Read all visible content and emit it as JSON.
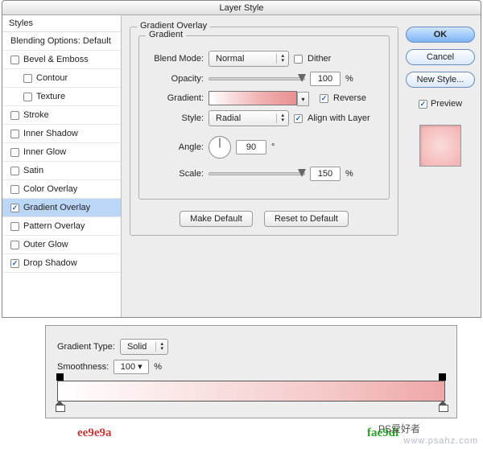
{
  "dialog": {
    "title": "Layer Style"
  },
  "sidebar": {
    "header": "Styles",
    "blending": "Blending Options: Default",
    "items": [
      {
        "label": "Bevel & Emboss",
        "checked": false,
        "sub": false
      },
      {
        "label": "Contour",
        "checked": false,
        "sub": true
      },
      {
        "label": "Texture",
        "checked": false,
        "sub": true
      },
      {
        "label": "Stroke",
        "checked": false,
        "sub": false
      },
      {
        "label": "Inner Shadow",
        "checked": false,
        "sub": false
      },
      {
        "label": "Inner Glow",
        "checked": false,
        "sub": false
      },
      {
        "label": "Satin",
        "checked": false,
        "sub": false
      },
      {
        "label": "Color Overlay",
        "checked": false,
        "sub": false
      },
      {
        "label": "Gradient Overlay",
        "checked": true,
        "sub": false,
        "selected": true
      },
      {
        "label": "Pattern Overlay",
        "checked": false,
        "sub": false
      },
      {
        "label": "Outer Glow",
        "checked": false,
        "sub": false
      },
      {
        "label": "Drop Shadow",
        "checked": true,
        "sub": false
      }
    ]
  },
  "gradientOverlay": {
    "groupLabel": "Gradient Overlay",
    "innerLabel": "Gradient",
    "blendModeLabel": "Blend Mode:",
    "blendMode": "Normal",
    "ditherLabel": "Dither",
    "opacityLabel": "Opacity:",
    "opacity": "100",
    "opacityUnit": "%",
    "gradientLabel": "Gradient:",
    "reverseLabel": "Reverse",
    "reverseChecked": true,
    "styleLabel": "Style:",
    "style": "Radial",
    "alignLabel": "Align with Layer",
    "alignChecked": true,
    "angleLabel": "Angle:",
    "angle": "90",
    "angleUnit": "°",
    "scaleLabel": "Scale:",
    "scale": "150",
    "scaleUnit": "%",
    "makeDefault": "Make Default",
    "resetDefault": "Reset to Default"
  },
  "rightButtons": {
    "ok": "OK",
    "cancel": "Cancel",
    "newStyle": "New Style...",
    "previewLabel": "Preview",
    "previewChecked": true
  },
  "gradientEditor": {
    "typeLabel": "Gradient Type:",
    "type": "Solid",
    "smoothLabel": "Smoothness:",
    "smooth": "100",
    "smoothUnit": "%"
  },
  "hex": {
    "left": "ee9e9a",
    "right": "fae9df"
  },
  "watermark": {
    "site": "www.psahz.com",
    "credit": "PS爱好者"
  }
}
